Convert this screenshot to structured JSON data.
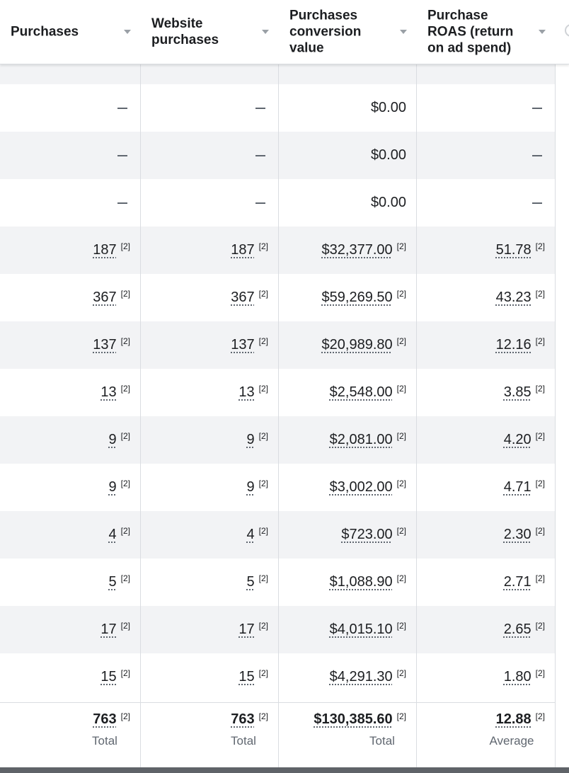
{
  "columns": [
    {
      "label": "Purchases"
    },
    {
      "label": "Website\npurchases"
    },
    {
      "label": "Purchases\nconversion\nvalue"
    },
    {
      "label": "Purchase\nROAS (return\non ad spend)"
    }
  ],
  "footnote": "[2]",
  "rows": [
    {
      "empty": true
    },
    {
      "purchases": "—",
      "website": "—",
      "value": "$0.00",
      "roas": "—",
      "linked": false
    },
    {
      "purchases": "—",
      "website": "—",
      "value": "$0.00",
      "roas": "—",
      "linked": false
    },
    {
      "purchases": "—",
      "website": "—",
      "value": "$0.00",
      "roas": "—",
      "linked": false
    },
    {
      "purchases": "187",
      "website": "187",
      "value": "$32,377.00",
      "roas": "51.78",
      "linked": true
    },
    {
      "purchases": "367",
      "website": "367",
      "value": "$59,269.50",
      "roas": "43.23",
      "linked": true
    },
    {
      "purchases": "137",
      "website": "137",
      "value": "$20,989.80",
      "roas": "12.16",
      "linked": true
    },
    {
      "purchases": "13",
      "website": "13",
      "value": "$2,548.00",
      "roas": "3.85",
      "linked": true
    },
    {
      "purchases": "9",
      "website": "9",
      "value": "$2,081.00",
      "roas": "4.20",
      "linked": true
    },
    {
      "purchases": "9",
      "website": "9",
      "value": "$3,002.00",
      "roas": "4.71",
      "linked": true
    },
    {
      "purchases": "4",
      "website": "4",
      "value": "$723.00",
      "roas": "2.30",
      "linked": true
    },
    {
      "purchases": "5",
      "website": "5",
      "value": "$1,088.90",
      "roas": "2.71",
      "linked": true
    },
    {
      "purchases": "17",
      "website": "17",
      "value": "$4,015.10",
      "roas": "2.65",
      "linked": true
    },
    {
      "purchases": "15",
      "website": "15",
      "value": "$4,291.30",
      "roas": "1.80",
      "linked": true
    }
  ],
  "totals": {
    "purchases": {
      "value": "763",
      "label": "Total"
    },
    "website": {
      "value": "763",
      "label": "Total"
    },
    "value": {
      "value": "$130,385.60",
      "label": "Total"
    },
    "roas": {
      "value": "12.88",
      "label": "Average"
    }
  },
  "colors": {
    "border": "#dadde1",
    "shade": "#f2f3f5",
    "text": "#1c1e21",
    "muted": "#606770"
  }
}
